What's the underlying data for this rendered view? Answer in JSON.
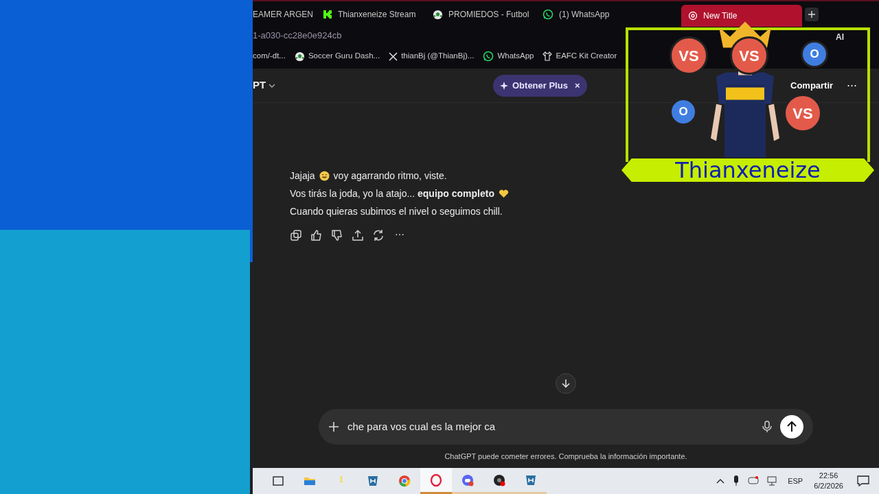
{
  "tabs": [
    {
      "label": "EAMER ARGEN",
      "selected": false
    },
    {
      "label": "Thianxeneize Stream",
      "selected": false
    },
    {
      "label": "PROMIEDOS - Futbol",
      "selected": false
    },
    {
      "label": "(1) WhatsApp",
      "selected": false
    },
    {
      "label": "New Title",
      "selected": true
    }
  ],
  "address": "1-a030-cc28e0e924cb",
  "toolbar": {
    "ai_label": "AI"
  },
  "bookmarks": [
    {
      "label": "com/-dt..."
    },
    {
      "label": "Soccer Guru Dash..."
    },
    {
      "label": "thianBj (@ThianBj)..."
    },
    {
      "label": "WhatsApp"
    },
    {
      "label": "EAFC Kit Creator"
    }
  ],
  "header": {
    "model": "PT",
    "promo": "Obtener Plus",
    "promo_close": "×",
    "share": "Compartir",
    "more": "⋯"
  },
  "message": {
    "lines": [
      [
        {
          "kind": "text",
          "text": "Jajaja"
        },
        {
          "kind": "smile"
        },
        {
          "kind": "text",
          "text": "voy agarrando ritmo, viste."
        }
      ],
      [
        {
          "kind": "text",
          "text": "Vos tirás la joda, yo la atajo... **equipo completo**"
        },
        {
          "kind": "heart"
        }
      ],
      [
        {
          "kind": "text",
          "text": "Cuando quieras subimos el nivel o seguimos chill."
        }
      ]
    ],
    "actions": [
      {
        "kind": "copy"
      },
      {
        "kind": "like"
      },
      {
        "kind": "dislike"
      },
      {
        "kind": "share"
      },
      {
        "kind": "retry"
      },
      {
        "kind": "more",
        "text": "⋯"
      }
    ]
  },
  "composer": {
    "value": "che para vos cual es la mejor ca"
  },
  "disclaimer": "ChatGPT puede cometer errores. Comprueba la información importante.",
  "overlay": {
    "name": "Thianxeneize",
    "badges": [
      {
        "text": "VS",
        "kind": "vs"
      },
      {
        "text": "VS",
        "kind": "vs"
      },
      {
        "text": "O",
        "kind": "o"
      },
      {
        "text": "O",
        "kind": "o"
      },
      {
        "text": "VS",
        "kind": "vs"
      }
    ]
  },
  "taskbar": {
    "apps": [
      {
        "kind": "taskview"
      },
      {
        "kind": "folder"
      },
      {
        "kind": "pin"
      },
      {
        "kind": "shield"
      },
      {
        "kind": "chrome"
      },
      {
        "kind": "opera",
        "selected": true
      },
      {
        "kind": "discord",
        "selected": false
      },
      {
        "kind": "obs",
        "selected": false
      },
      {
        "kind": "shield",
        "selected": false
      }
    ],
    "language": "ESP",
    "time": "22:56",
    "date": "6/2/2026"
  }
}
